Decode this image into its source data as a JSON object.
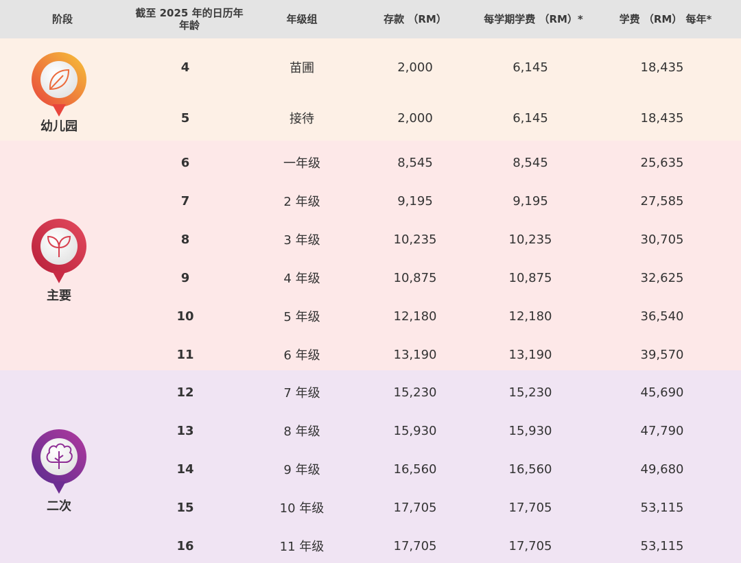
{
  "headers": {
    "stage": "阶段",
    "age_line1": "截至 2025 年的日历年",
    "age_line2": "年龄",
    "grade": "年级组",
    "deposit": "存款 （RM）",
    "term_fee": "每学期学费 （RM）*",
    "annual_fee": "学费 （RM） 每年*"
  },
  "stages": [
    {
      "label": "幼儿园",
      "icon": "leaf-icon",
      "colors": [
        "#f6c33a",
        "#e8453c"
      ]
    },
    {
      "label": "主要",
      "icon": "sprout-icon",
      "colors": [
        "#e34b5e",
        "#b81f3a"
      ]
    },
    {
      "label": "二次",
      "icon": "tree-icon",
      "colors": [
        "#b13a9e",
        "#5b2c8f"
      ]
    }
  ],
  "rows": [
    {
      "age": "4",
      "grade": "苗圃",
      "deposit": "2,000",
      "term_fee": "6,145",
      "annual_fee": "18,435"
    },
    {
      "age": "5",
      "grade": "接待",
      "deposit": "2,000",
      "term_fee": "6,145",
      "annual_fee": "18,435"
    },
    {
      "age": "6",
      "grade": "一年级",
      "deposit": "8,545",
      "term_fee": "8,545",
      "annual_fee": "25,635"
    },
    {
      "age": "7",
      "grade": "2 年级",
      "deposit": "9,195",
      "term_fee": "9,195",
      "annual_fee": "27,585"
    },
    {
      "age": "8",
      "grade": "3 年级",
      "deposit": "10,235",
      "term_fee": "10,235",
      "annual_fee": "30,705"
    },
    {
      "age": "9",
      "grade": "4 年级",
      "deposit": "10,875",
      "term_fee": "10,875",
      "annual_fee": "32,625"
    },
    {
      "age": "10",
      "grade": "5 年级",
      "deposit": "12,180",
      "term_fee": "12,180",
      "annual_fee": "36,540"
    },
    {
      "age": "11",
      "grade": "6 年级",
      "deposit": "13,190",
      "term_fee": "13,190",
      "annual_fee": "39,570"
    },
    {
      "age": "12",
      "grade": "7 年级",
      "deposit": "15,230",
      "term_fee": "15,230",
      "annual_fee": "45,690"
    },
    {
      "age": "13",
      "grade": "8 年级",
      "deposit": "15,930",
      "term_fee": "15,930",
      "annual_fee": "47,790"
    },
    {
      "age": "14",
      "grade": "9 年级",
      "deposit": "16,560",
      "term_fee": "16,560",
      "annual_fee": "49,680"
    },
    {
      "age": "15",
      "grade": "10 年级",
      "deposit": "17,705",
      "term_fee": "17,705",
      "annual_fee": "53,115"
    },
    {
      "age": "16",
      "grade": "11 年级",
      "deposit": "17,705",
      "term_fee": "17,705",
      "annual_fee": "53,115"
    }
  ],
  "colors": {
    "header_bg": "#e4e4e4",
    "kindergarten_bg": "#fdf0e6",
    "primary_bg": "#fde8e8",
    "secondary_bg": "#f0e4f3"
  }
}
